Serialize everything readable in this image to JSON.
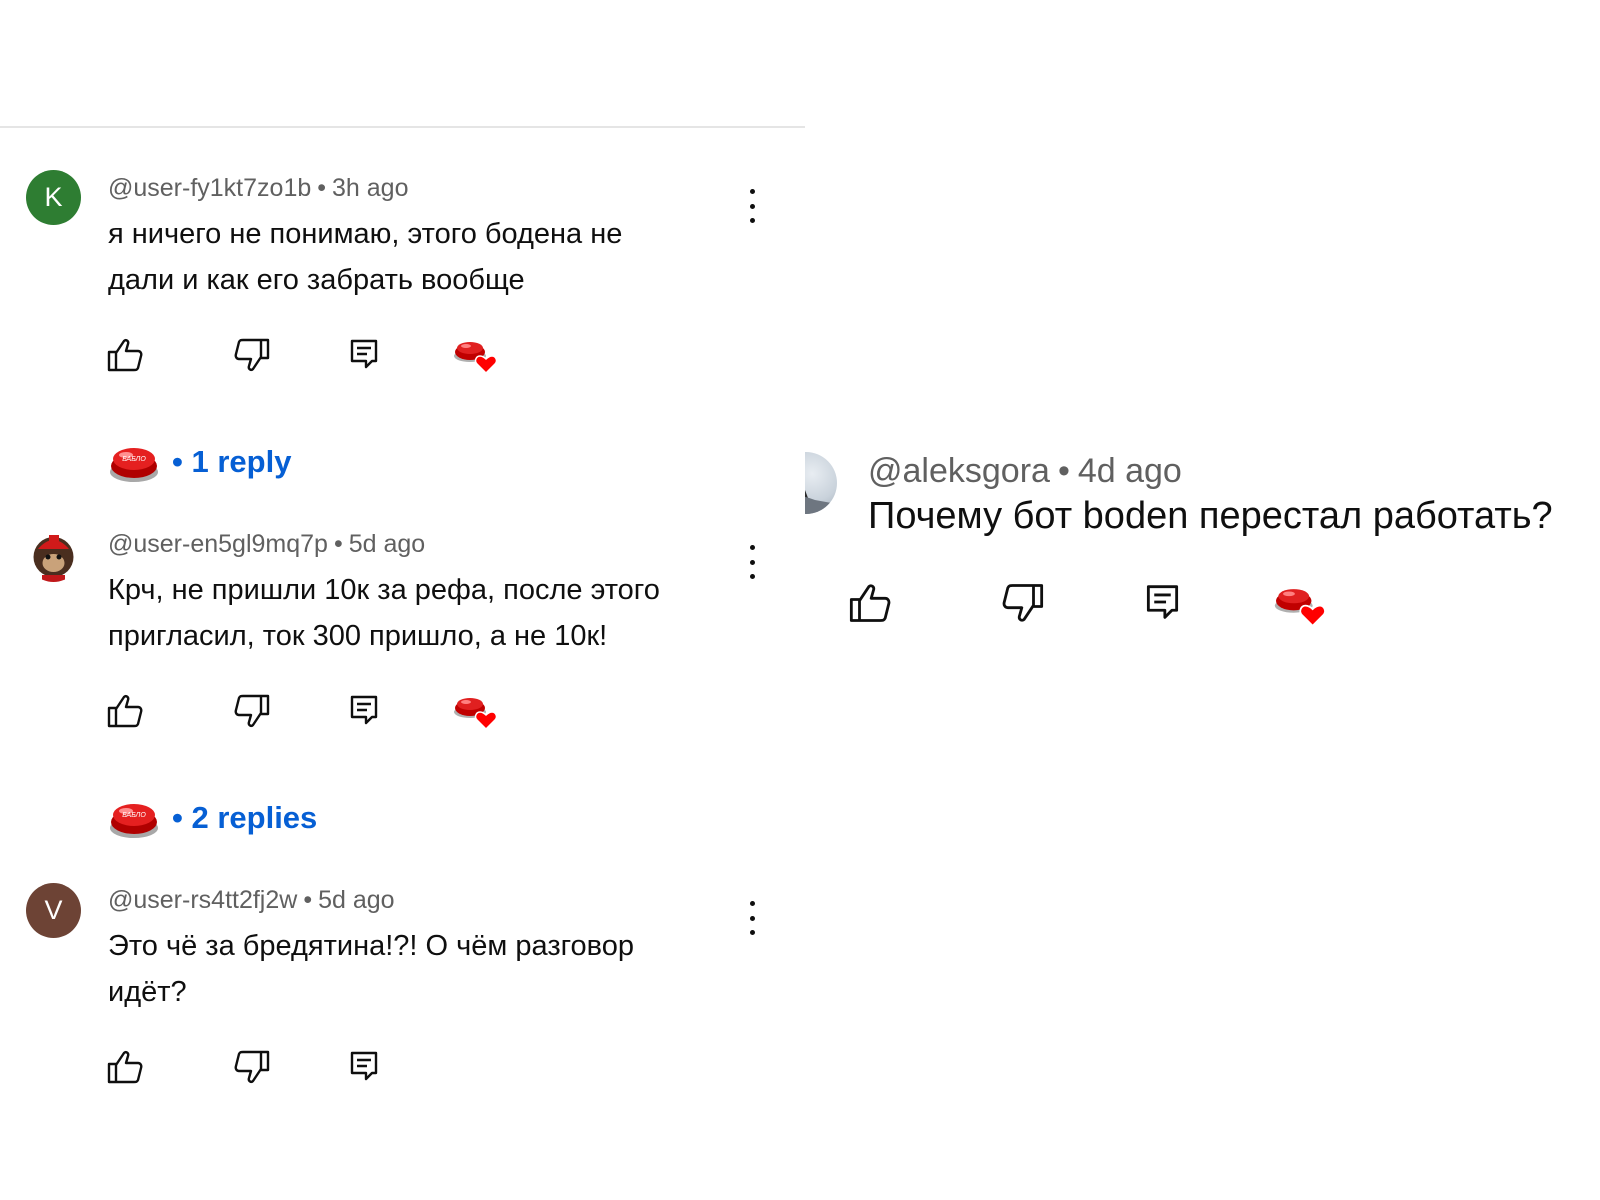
{
  "comments": [
    {
      "avatar_letter": "K",
      "author": "@user-fy1kt7zo1b",
      "time": "3h ago",
      "text_lines": [
        "я ничего не понимаю, этого бодена не",
        "дали и как его забрать вообще"
      ],
      "replies": "1 reply"
    },
    {
      "avatar_letter": "",
      "author": "@user-en5gl9mq7p",
      "time": "5d ago",
      "text_lines": [
        "Крч, не пришли 10к за рефа, после этого",
        "пригласил, ток 300 пришло, а не 10к!"
      ],
      "replies": "2 replies"
    },
    {
      "avatar_letter": "V",
      "author": "@user-rs4tt2fj2w",
      "time": "5d ago",
      "text_lines": [
        "Это чё за бредятина!?! О чём разговор",
        "идёт?"
      ]
    }
  ],
  "right_comment": {
    "author": "@aleksgora",
    "time": "4d ago",
    "text": "Почему бот boden перестал работать?"
  },
  "separator": "•",
  "creator_badge_text": "БАБЛО",
  "colors": {
    "link": "#065fd4",
    "meta": "#606060",
    "avatar_k": "#2e7d32",
    "avatar_v": "#6d4335",
    "heart": "#ff0000"
  },
  "icons": [
    "thumb-up-icon",
    "thumb-down-icon",
    "reply-icon",
    "creator-heart-icon",
    "more-vert-icon"
  ]
}
